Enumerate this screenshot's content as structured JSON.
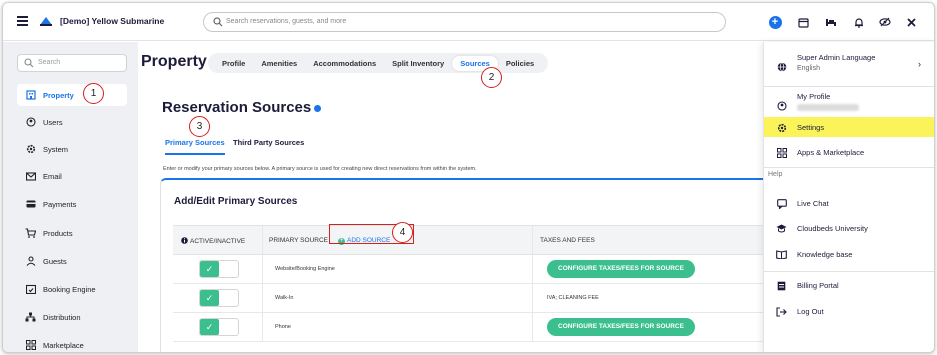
{
  "topbar": {
    "title": "[Demo] Yellow Submarine",
    "search_placeholder": "Search reservations, guests, and more"
  },
  "sidebar": {
    "search_placeholder": "Search",
    "items": [
      {
        "label": "Property",
        "icon": "building-icon"
      },
      {
        "label": "Users",
        "icon": "user-circle-icon"
      },
      {
        "label": "System",
        "icon": "gear-icon"
      },
      {
        "label": "Email",
        "icon": "envelope-icon"
      },
      {
        "label": "Payments",
        "icon": "credit-card-icon"
      },
      {
        "label": "Products",
        "icon": "cart-icon"
      },
      {
        "label": "Guests",
        "icon": "person-icon"
      },
      {
        "label": "Booking Engine",
        "icon": "calendar-check-icon"
      },
      {
        "label": "Distribution",
        "icon": "network-icon"
      },
      {
        "label": "Marketplace",
        "icon": "apps-grid-icon"
      }
    ]
  },
  "page": {
    "title": "Property",
    "tabs": [
      "Profile",
      "Amenities",
      "Accommodations",
      "Split Inventory",
      "Sources",
      "Policies"
    ],
    "selected_tab": "Sources",
    "section_title": "Reservation Sources",
    "subtabs": [
      "Primary Sources",
      "Third Party Sources"
    ],
    "help_text": "Enter or modify your primary sources below. A primary source is used for creating new direct reservations from within the system.",
    "card_title": "Add/Edit Primary Sources",
    "columns": {
      "active": "ACTIVE/INACTIVE",
      "primary_source": "PRIMARY SOURCE",
      "add_source": "ADD SOURCE",
      "taxes": "TAXES AND FEES"
    },
    "rows": [
      {
        "name": "Website/Booking Engine",
        "taxes_button": "CONFIGURE TAXES/FEES FOR SOURCE",
        "taxes_text": null
      },
      {
        "name": "Walk-In",
        "taxes_button": null,
        "taxes_text": "IVA; CLEANING FEE"
      },
      {
        "name": "Phone",
        "taxes_button": "CONFIGURE TAXES/FEES FOR SOURCE",
        "taxes_text": null
      }
    ]
  },
  "callouts": [
    "1",
    "2",
    "3",
    "4"
  ],
  "menu": {
    "language_title": "Super Admin Language",
    "language_value": "English",
    "profile": "My Profile",
    "settings": "Settings",
    "apps": "Apps & Marketplace",
    "help_header": "Help",
    "live_chat": "Live Chat",
    "university": "Cloudbeds University",
    "knowledge": "Knowledge base",
    "billing": "Billing Portal",
    "logout": "Log Out"
  },
  "colors": {
    "accent": "#1a73e8",
    "success": "#3cbf8f",
    "highlight": "#fbf35a",
    "callout": "#d32020"
  }
}
